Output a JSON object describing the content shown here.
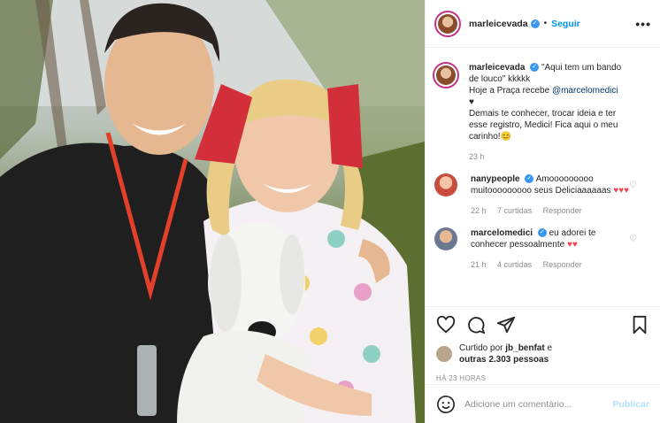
{
  "header": {
    "username": "marleicevada",
    "follow_label": "Seguir",
    "more_label": "•••"
  },
  "caption": {
    "username": "marleicevada",
    "line1": "\"Aqui tem um bando de louco\" kkkkk",
    "line2_pre": "Hoje a Praça recebe ",
    "line2_mention": "@marcelomedici",
    "line3": "♥",
    "line4": "Demais te conhecer, trocar ideia e ter esse registro, Medici! Fica aqui o meu carinho!😊",
    "time": "23 h"
  },
  "comments": [
    {
      "username": "nanypeople",
      "text": "Amooooooooo muitooooooooo seus Deliciaaaaaas",
      "emoji": "♥♥♥",
      "time": "22 h",
      "likes": "7 curtidas",
      "reply": "Responder",
      "avatar_color": "#c94b3d"
    },
    {
      "username": "marcelomedici",
      "text": "eu adorei te conhecer pessoalmente",
      "emoji": "♥♥",
      "time": "21 h",
      "likes": "4 curtidas",
      "reply": "Responder",
      "avatar_color": "#8e9ab0"
    }
  ],
  "likes": {
    "prefix": "Curtido por ",
    "user": "jb_benfat",
    "connector": " e",
    "others": "outras 2.303 pessoas"
  },
  "timestamp": "HÁ 23 HORAS",
  "add_comment": {
    "placeholder": "Adicione um comentário...",
    "publish": "Publicar"
  },
  "icons": [
    "heart-icon",
    "comment-icon",
    "share-icon",
    "bookmark-icon",
    "emoji-icon"
  ]
}
